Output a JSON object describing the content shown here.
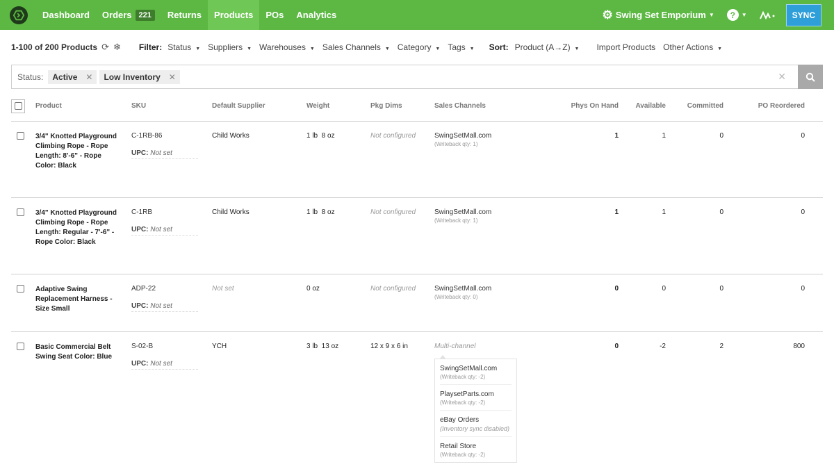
{
  "nav": {
    "items": [
      {
        "label": "Dashboard",
        "active": false
      },
      {
        "label": "Orders",
        "active": false,
        "badge": "221"
      },
      {
        "label": "Returns",
        "active": false
      },
      {
        "label": "Products",
        "active": true
      },
      {
        "label": "POs",
        "active": false
      },
      {
        "label": "Analytics",
        "active": false
      }
    ],
    "store_name": "Swing Set Emporium",
    "help": "?",
    "sync_label": "SYNC",
    "colors": {
      "bar": "#5cb843",
      "active": "#6fc756",
      "sync": "#2e9fd8"
    }
  },
  "toolbar": {
    "count": "1-100 of 200 Products",
    "filter_label": "Filter:",
    "filters": [
      "Status",
      "Suppliers",
      "Warehouses",
      "Sales Channels",
      "Category",
      "Tags"
    ],
    "sort_label": "Sort:",
    "sort_value": "Product (A→Z)",
    "import": "Import Products",
    "other": "Other Actions"
  },
  "search": {
    "status_label": "Status:",
    "chips": [
      "Active",
      "Low Inventory"
    ]
  },
  "table": {
    "headers": {
      "product": "Product",
      "sku": "SKU",
      "supplier": "Default Supplier",
      "weight": "Weight",
      "dims": "Pkg Dims",
      "channels": "Sales Channels",
      "on_hand": "Phys On Hand",
      "available": "Available",
      "committed": "Committed",
      "po": "PO Reordered"
    },
    "upc_label": "UPC:",
    "rows": [
      {
        "product": "3/4\" Knotted Playground Climbing Rope - Rope Length: 8'-6\" - Rope Color: Black",
        "sku": "C-1RB-86",
        "upc": "Not set",
        "supplier": "Child Works",
        "weight": "1 lb  8 oz",
        "dims": "Not configured",
        "channel": "SwingSetMall.com",
        "channel_sub": "(Writeback qty: 1)",
        "on_hand": "1",
        "available": "1",
        "committed": "0",
        "po": "0"
      },
      {
        "product": "3/4\" Knotted Playground Climbing Rope - Rope Length: Regular - 7'-6\" - Rope Color: Black",
        "sku": "C-1RB",
        "upc": "Not set",
        "supplier": "Child Works",
        "weight": "1 lb  8 oz",
        "dims": "Not configured",
        "channel": "SwingSetMall.com",
        "channel_sub": "(Writeback qty: 1)",
        "on_hand": "1",
        "available": "1",
        "committed": "0",
        "po": "0"
      },
      {
        "product": "Adaptive Swing Replacement Harness - Size Small",
        "sku": "ADP-22",
        "upc": "Not set",
        "supplier": "Not set",
        "weight": "0 oz",
        "dims": "Not configured",
        "channel": "SwingSetMall.com",
        "channel_sub": "(Writeback qty: 0)",
        "on_hand": "0",
        "available": "0",
        "committed": "0",
        "po": "0"
      },
      {
        "product": "Basic Commercial Belt Swing Seat Color: Blue",
        "sku": "S-02-B",
        "upc": "Not set",
        "supplier": "YCH",
        "weight": "3 lb  13 oz",
        "dims": "12 x 9 x 6 in",
        "channel": "Multi-channel",
        "on_hand": "0",
        "available": "-2",
        "committed": "2",
        "po": "800",
        "popup": [
          {
            "name": "SwingSetMall.com",
            "sub": "(Writeback qty: -2)"
          },
          {
            "name": "PlaysetParts.com",
            "sub": "(Writeback qty: -2)"
          },
          {
            "name": "eBay Orders",
            "sub": "(Inventory sync disabled)"
          },
          {
            "name": "Retail Store",
            "sub": "(Writeback qty: -2)"
          }
        ]
      }
    ]
  }
}
